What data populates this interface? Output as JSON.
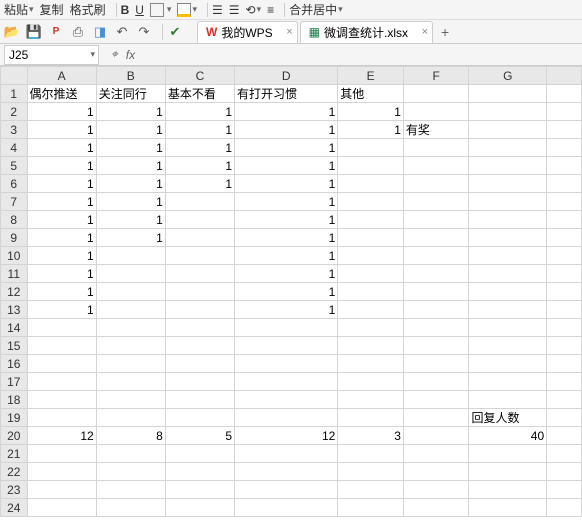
{
  "top_toolbar": {
    "paste_label": "粘贴",
    "copy_label": "复制",
    "format_brush": "格式刷",
    "merge_center": "合并居中"
  },
  "tabs": {
    "wps_home": "我的WPS",
    "file_name": "微调查统计.xlsx"
  },
  "name_box": {
    "value": "J25"
  },
  "columns": [
    "A",
    "B",
    "C",
    "D",
    "E",
    "F",
    "G"
  ],
  "headers": {
    "A": "偶尔推送",
    "B": "关注同行",
    "C": "基本不看",
    "D": "有打开习惯",
    "E": "其他",
    "F_row3": "有奖",
    "G_row19": "回复人数"
  },
  "cells": {
    "r2": {
      "A": "1",
      "B": "1",
      "C": "1",
      "D": "1",
      "E": "1"
    },
    "r3": {
      "A": "1",
      "B": "1",
      "C": "1",
      "D": "1",
      "E": "1"
    },
    "r4": {
      "A": "1",
      "B": "1",
      "C": "1",
      "D": "1"
    },
    "r5": {
      "A": "1",
      "B": "1",
      "C": "1",
      "D": "1"
    },
    "r6": {
      "A": "1",
      "B": "1",
      "C": "1",
      "D": "1"
    },
    "r7": {
      "A": "1",
      "B": "1",
      "D": "1"
    },
    "r8": {
      "A": "1",
      "B": "1",
      "D": "1"
    },
    "r9": {
      "A": "1",
      "B": "1",
      "D": "1"
    },
    "r10": {
      "A": "1",
      "D": "1"
    },
    "r11": {
      "A": "1",
      "D": "1"
    },
    "r12": {
      "A": "1",
      "D": "1"
    },
    "r13": {
      "A": "1",
      "D": "1"
    },
    "r20": {
      "A": "12",
      "B": "8",
      "C": "5",
      "D": "12",
      "E": "3",
      "G": "40"
    }
  },
  "row_count": 24
}
